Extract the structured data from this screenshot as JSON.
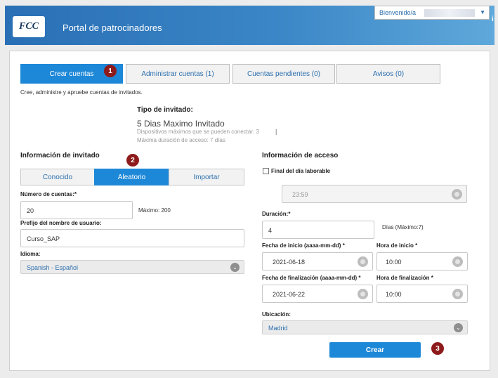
{
  "header": {
    "logo_text": "FCC",
    "title": "Portal de patrocinadores",
    "welcome": "Bienvenido/a",
    "info_icon": "i"
  },
  "tabs": [
    {
      "label": "Crear cuentas",
      "active": true
    },
    {
      "label": "Administrar cuentas (1)",
      "active": false
    },
    {
      "label": "Cuentas pendientes (0)",
      "active": false
    },
    {
      "label": "Avisos (0)",
      "active": false
    }
  ],
  "badges": [
    "1",
    "2",
    "3"
  ],
  "intro": "Cree, administre y apruebe cuentas de invitados.",
  "guest_type": {
    "label": "Tipo de invitado:",
    "name": "5 Dias Maximo Invitado",
    "devices": "Dispositivos máximos que se pueden conectar: 3",
    "separator": "|",
    "duration": "Máxima duración de acceso: 7 días"
  },
  "guest_info": {
    "heading": "Información de invitado",
    "segments": [
      {
        "label": "Conocido",
        "active": false
      },
      {
        "label": "Aleatorio",
        "active": true
      },
      {
        "label": "Importar",
        "active": false
      }
    ],
    "accounts_label": "Número de cuentas:*",
    "accounts_value": "20",
    "accounts_max": "Máximo: 200",
    "prefix_label": "Prefijo del nombre de usuario:",
    "prefix_value": "Curso_SAP",
    "language_label": "Idioma:",
    "language_value": "Spanish - Español"
  },
  "access_info": {
    "heading": "Información de acceso",
    "end_of_day_label": "Final del día laborable",
    "end_of_day_time": "23:59",
    "duration_label": "Duración:*",
    "duration_value": "4",
    "duration_hint": "Días (Máximo:7)",
    "start_date_label": "Fecha de inicio (aaaa-mm-dd) *",
    "start_date_value": "2021-06-18",
    "start_time_label": "Hora de inicio *",
    "start_time_value": "10:00",
    "end_date_label": "Fecha de finalización (aaaa-mm-dd) *",
    "end_date_value": "2021-06-22",
    "end_time_label": "Hora de finalización *",
    "end_time_value": "10:00",
    "location_label": "Ubicación:",
    "location_value": "Madrid"
  },
  "submit_label": "Crear",
  "colors": {
    "accent": "#1e88d8",
    "badge": "#8e1b1b",
    "header": "#2a6fb5"
  }
}
